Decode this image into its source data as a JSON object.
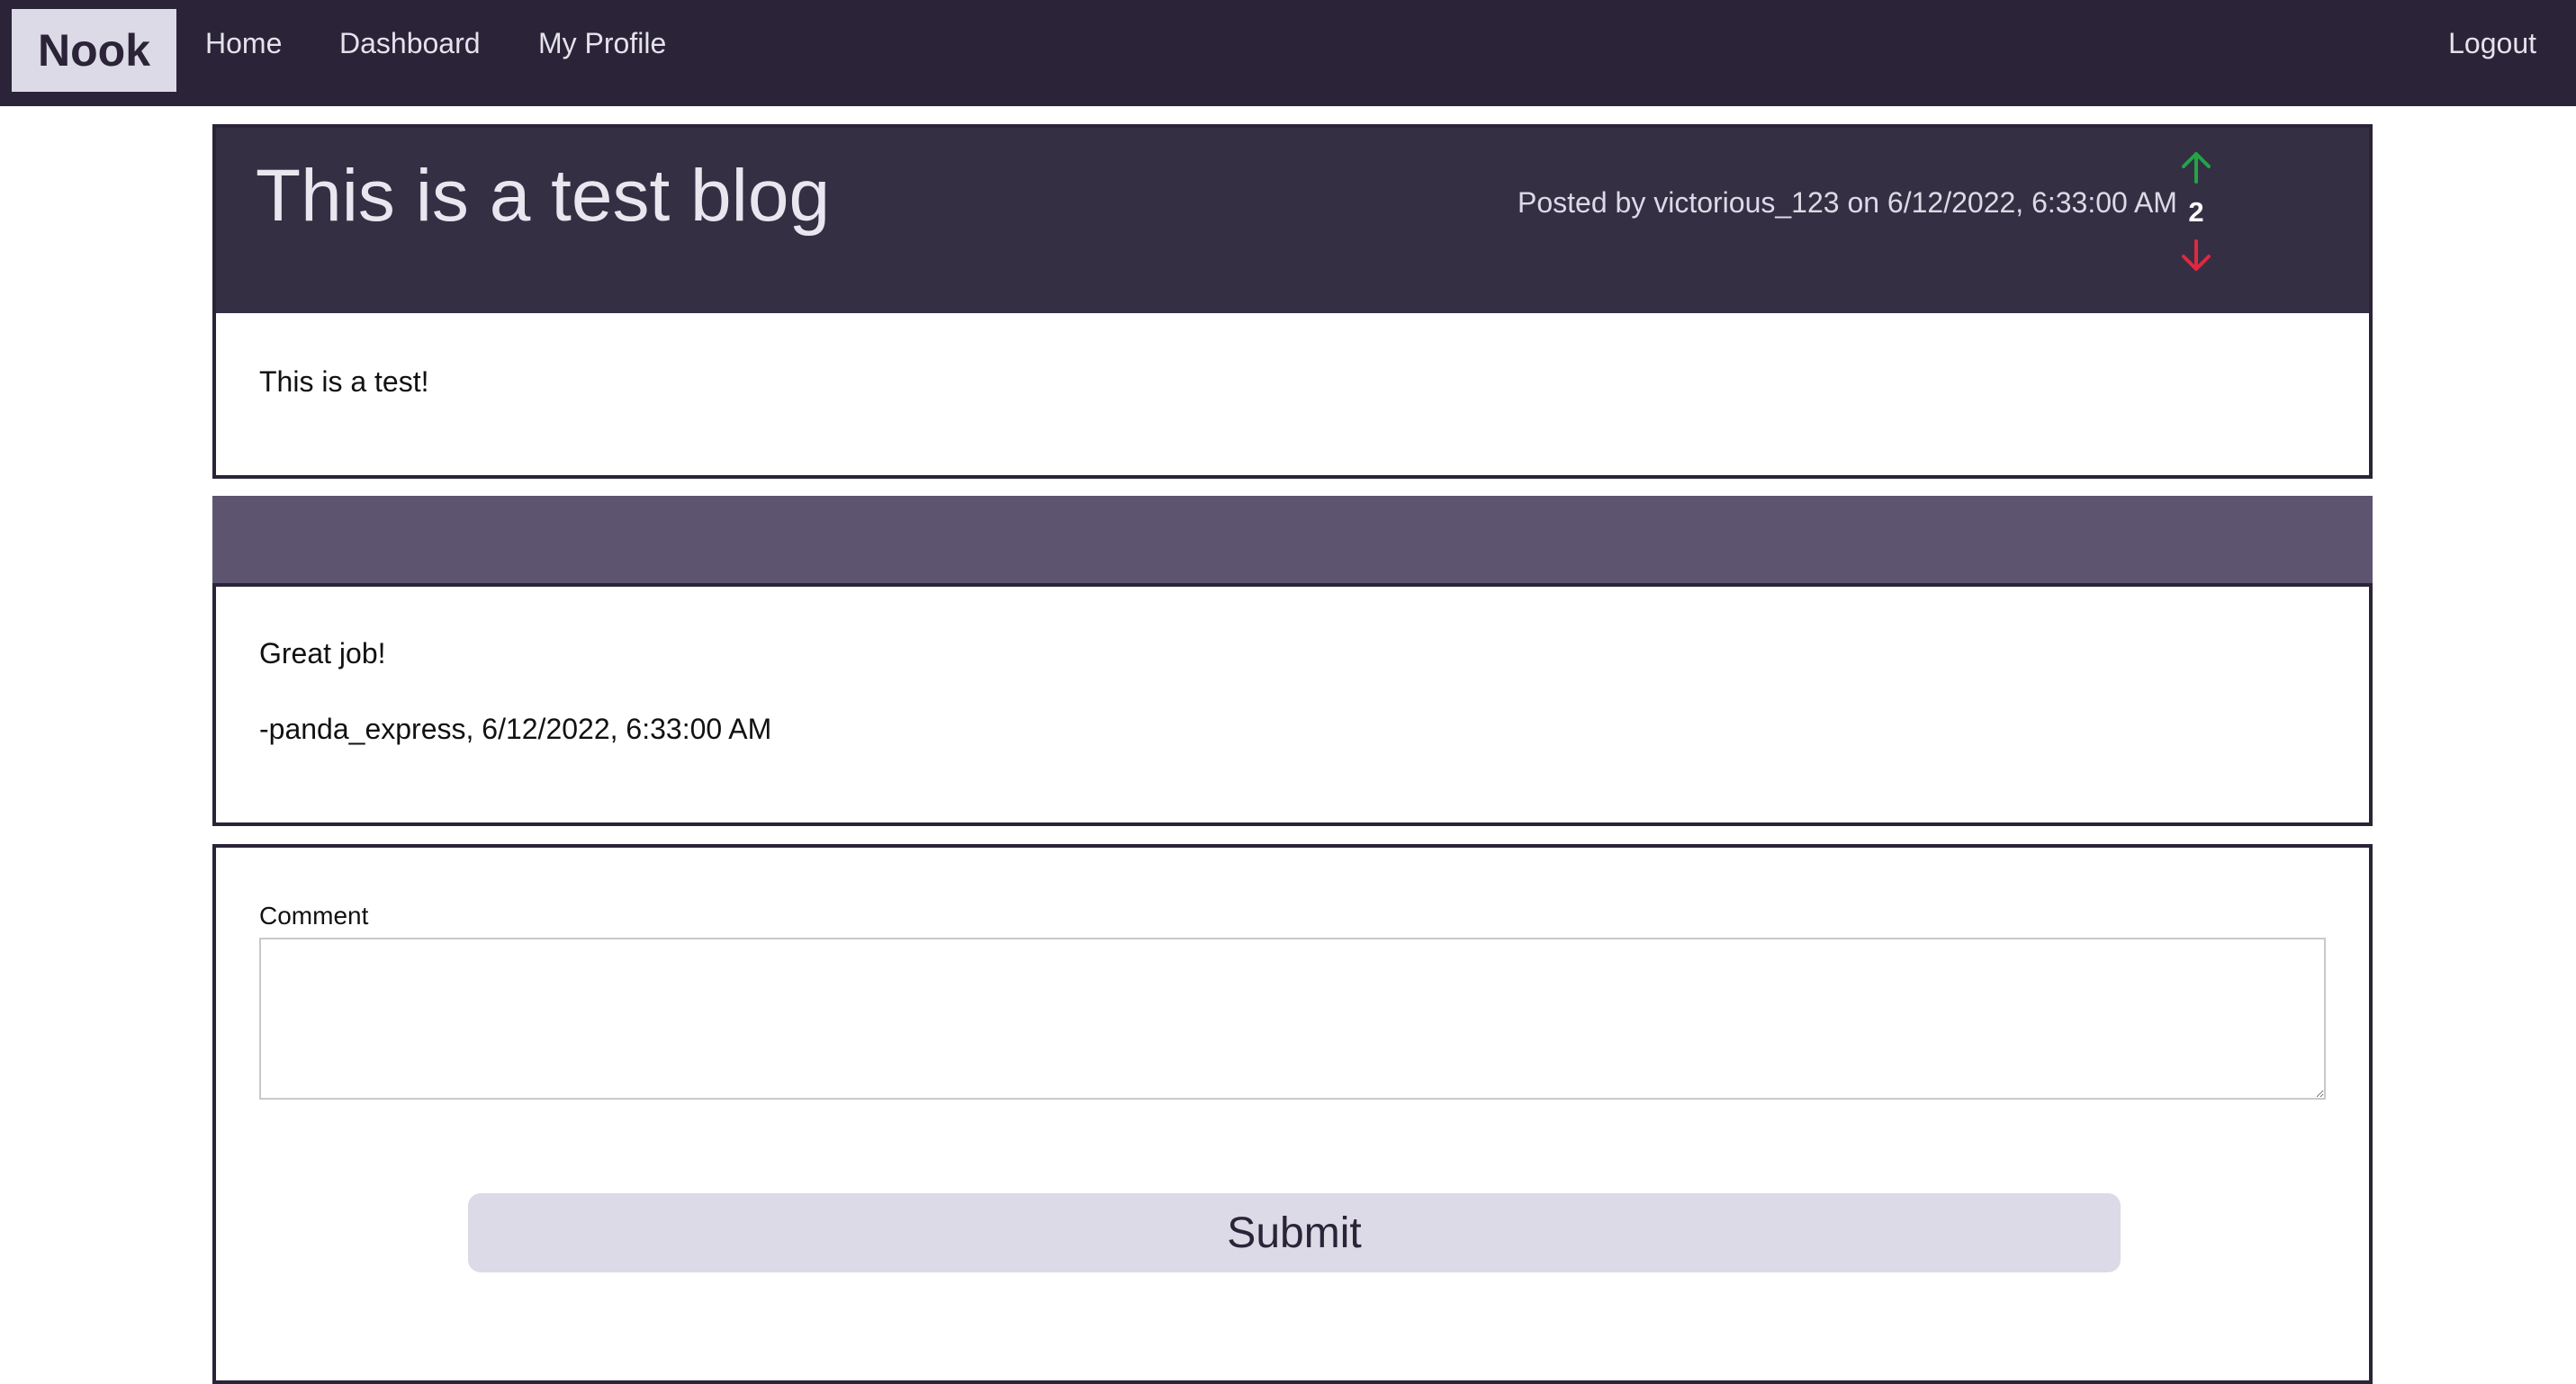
{
  "navbar": {
    "brand": "Nook",
    "links": [
      {
        "label": "Home"
      },
      {
        "label": "Dashboard"
      },
      {
        "label": "My Profile"
      }
    ],
    "logout_label": "Logout"
  },
  "post": {
    "title": "This is a test blog",
    "meta": "Posted by victorious_123 on 6/12/2022, 6:33:00 AM",
    "votes": "2",
    "body": "This is a test!"
  },
  "comments": [
    {
      "text": "Great job!",
      "attribution": "-panda_express, 6/12/2022, 6:33:00 AM"
    }
  ],
  "form": {
    "label": "Comment",
    "value": "",
    "submit_label": "Submit"
  },
  "colors": {
    "navbar_bg": "#2b2438",
    "brand_bg": "#dcdae6",
    "post_header_bg": "#352f44",
    "comment_header_bg": "#5d556f",
    "upvote": "#22a447",
    "downvote": "#e0283e",
    "button_bg": "#dcdae6"
  },
  "icons": {
    "upvote": "arrow-up-icon",
    "downvote": "arrow-down-icon"
  }
}
